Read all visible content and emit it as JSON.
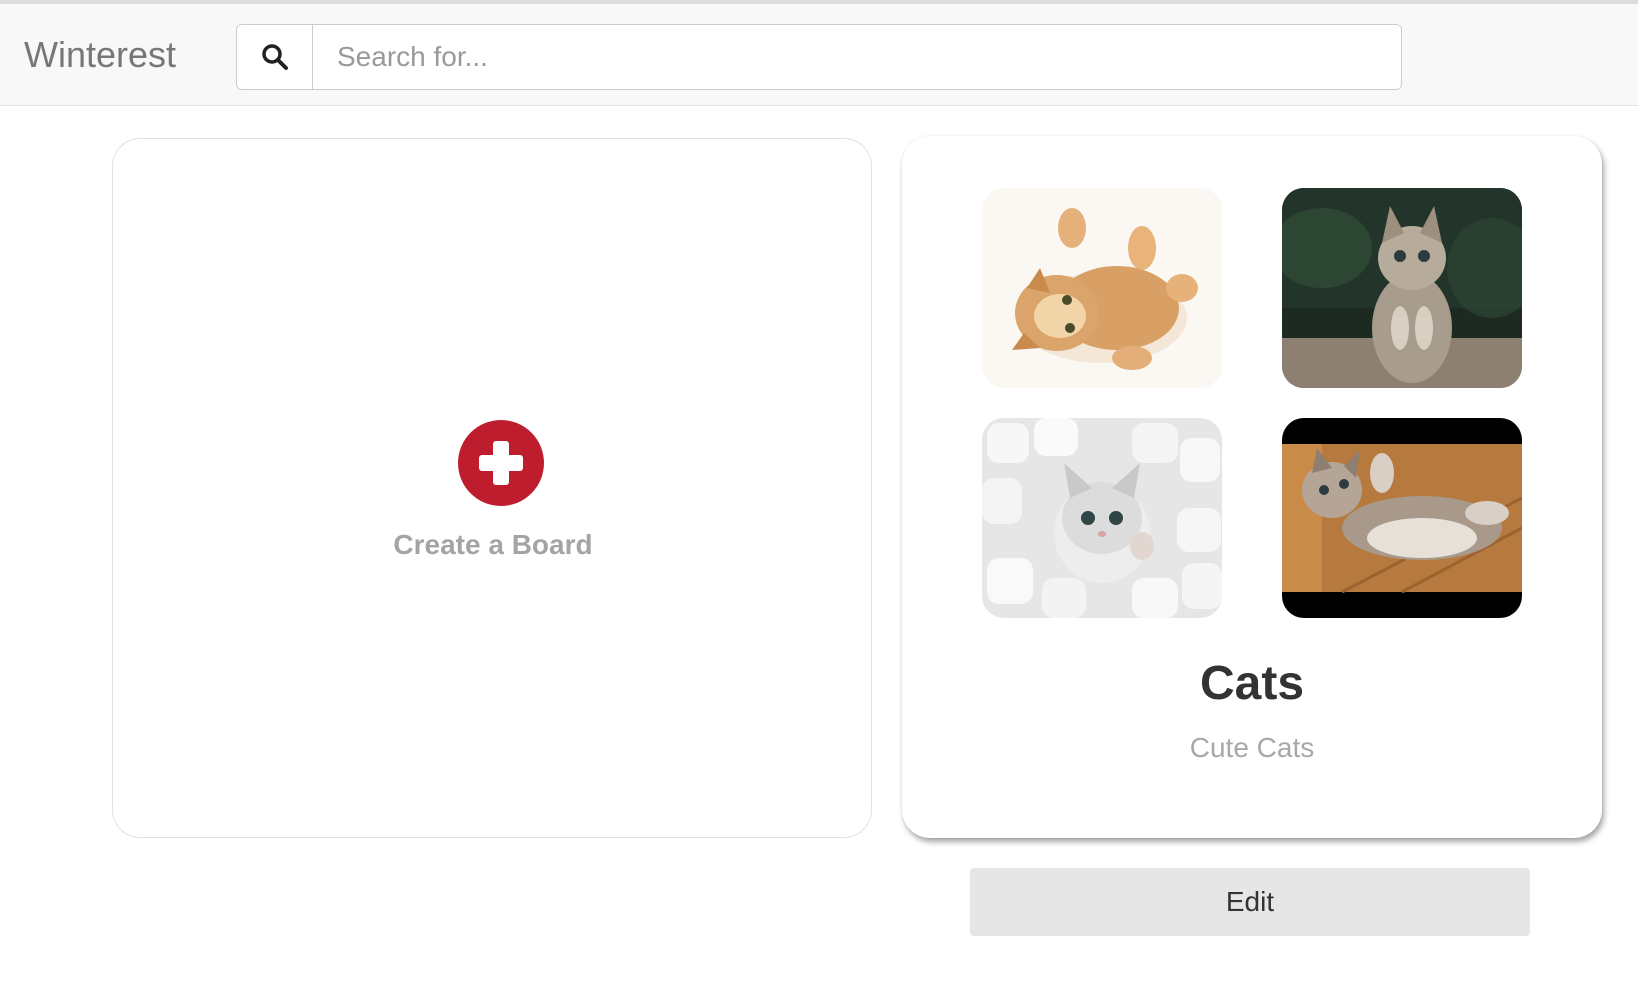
{
  "navbar": {
    "brand": "Winterest",
    "search": {
      "icon": "search-icon",
      "placeholder": "Search for...",
      "value": ""
    }
  },
  "create_board": {
    "icon": "plus-circle-icon",
    "label": "Create a Board",
    "icon_color": "#bd1d2d"
  },
  "board": {
    "title": "Cats",
    "description": "Cute Cats",
    "thumbnails": [
      {
        "subject": "orange kitten lying on back"
      },
      {
        "subject": "tabby kitten with paws up on grass"
      },
      {
        "subject": "white kitten among marshmallows"
      },
      {
        "subject": "tabby kitten lying on wooden floor"
      }
    ],
    "edit_label": "Edit"
  }
}
